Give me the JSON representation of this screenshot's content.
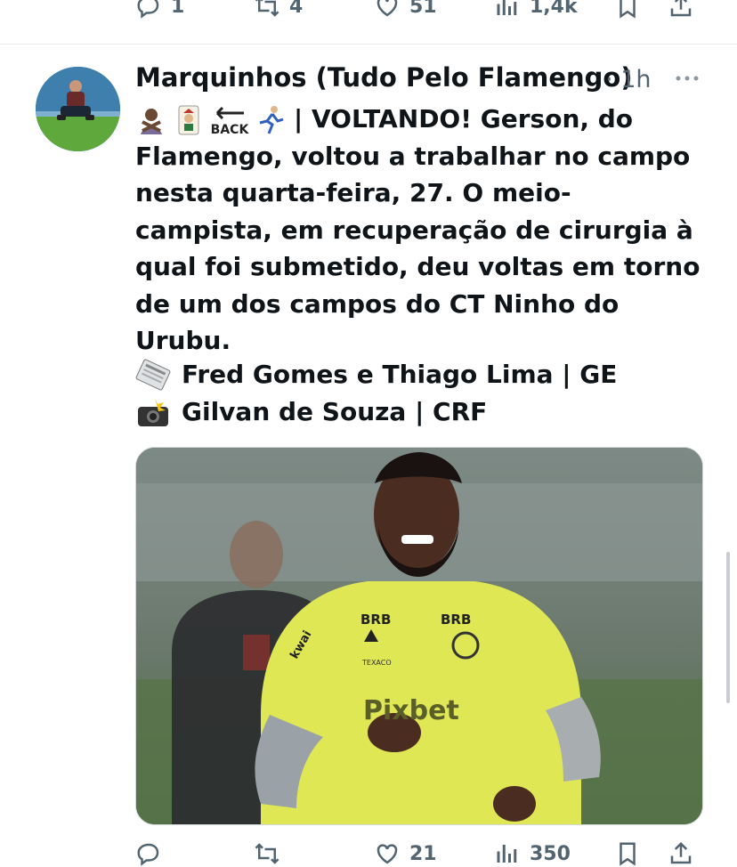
{
  "top_actions": {
    "reply_count": "1",
    "retweet_count": "4",
    "like_count": "51",
    "views_count": "1,4k"
  },
  "tweet": {
    "author_name": "Marquinhos (Tudo Pelo Flamengo)",
    "separator": "·",
    "time": "1h",
    "emojis": [
      "man-gesturing-no",
      "joker-card",
      "back-arrow",
      "running-man"
    ],
    "back_label": "BACK",
    "text": "| VOLTANDO! Gerson, do Flamengo, voltou a trabalhar no campo nesta quarta-feira, 27. O meio-campista, em recuperação de cirurgia à qual foi submetido, deu voltas em torno de um dos campos do CT Ninho do Urubu.",
    "credits": [
      {
        "icon": "newspaper-icon",
        "text": "Fred Gomes e Thiago Lima | GE"
      },
      {
        "icon": "camera-flash-icon",
        "text": "Gilvan de Souza | CRF"
      }
    ],
    "media": {
      "alt_subject": "soccer-player-photo",
      "jersey_texts": [
        "BRB",
        "BRB",
        "kwai",
        "TEXACO",
        "Pixbet"
      ]
    },
    "actions": {
      "reply_count": "",
      "retweet_count": "",
      "like_count": "21",
      "views_count": "350"
    }
  },
  "colors": {
    "text": "#0f1419",
    "muted": "#536471",
    "divider": "#e6e9ec",
    "jersey": "#e6ee5a"
  }
}
